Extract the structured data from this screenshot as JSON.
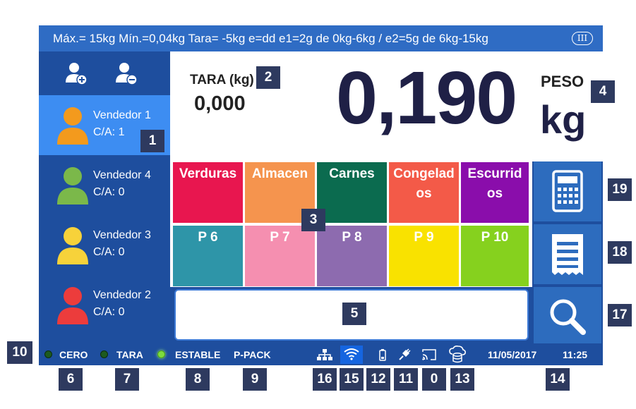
{
  "header": {
    "spec_text": "Máx.= 15kg  Mín.=0,04kg  Tara= -5kg  e=dd  e1=2g de 0kg-6kg / e2=5g de 6kg-15kg",
    "class_badge": "III"
  },
  "sidebar": {
    "add_icon": "add-user-icon",
    "remove_icon": "remove-user-icon",
    "sellers": [
      {
        "name": "Vendedor 1",
        "ca": "C/A: 1",
        "color": "#f39a1d",
        "active": true
      },
      {
        "name": "Vendedor 4",
        "ca": "C/A: 0",
        "color": "#7bb84a",
        "active": false
      },
      {
        "name": "Vendedor 3",
        "ca": "C/A: 0",
        "color": "#f7d23a",
        "active": false
      },
      {
        "name": "Vendedor 2",
        "ca": "C/A: 0",
        "color": "#ec3c3c",
        "active": false
      }
    ]
  },
  "display": {
    "tara_label": "TARA (kg)",
    "tara_value": "0,000",
    "weight_value": "0,190",
    "peso_label": "PESO",
    "unit": "kg"
  },
  "categories": {
    "row1": [
      {
        "label": "Verduras",
        "color": "#e8164f"
      },
      {
        "label": "Almacen",
        "color": "#f5944e"
      },
      {
        "label": "Carnes",
        "color": "#0b6b4f"
      },
      {
        "label": "Congelados",
        "color": "#f35a48"
      },
      {
        "label": "Escurridos",
        "color": "#8a0dab"
      }
    ],
    "row2": [
      {
        "label": "P 6",
        "color": "#2e95a8"
      },
      {
        "label": "P 7",
        "color": "#f58fb0"
      },
      {
        "label": "P 8",
        "color": "#8d6baf"
      },
      {
        "label": "P 9",
        "color": "#f9e200"
      },
      {
        "label": "P 10",
        "color": "#86d11e"
      }
    ]
  },
  "side_buttons": [
    {
      "icon": "calculator-icon"
    },
    {
      "icon": "receipt-icon"
    },
    {
      "icon": "search-icon"
    }
  ],
  "status": {
    "zero_label": "CERO",
    "tare_label": "TARA",
    "stable_label": "ESTABLE",
    "ppack_label": "P-PACK",
    "date": "11/05/2017",
    "time": "11:25",
    "icons": [
      "network-icon",
      "wifi-icon",
      "battery-icon",
      "power-plug-icon",
      "cast-icon",
      "cloud-database-icon"
    ]
  },
  "callouts": [
    "1",
    "2",
    "3",
    "4",
    "5",
    "6",
    "7",
    "8",
    "9",
    "10",
    "0",
    "11",
    "12",
    "13",
    "14",
    "15",
    "16",
    "17",
    "18",
    "19"
  ],
  "colors": {
    "frame_blue": "#1e4e9e",
    "header_blue": "#2f6cc4",
    "active_seller": "#3d8df2",
    "callout_bg": "#2e3a5f",
    "weight_text": "#1f2046"
  }
}
